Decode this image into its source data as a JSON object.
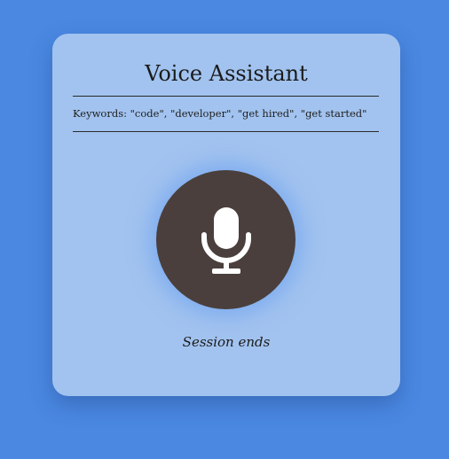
{
  "app": {
    "title": "Voice Assistant",
    "keywords_text": "Keywords: \"code\", \"developer\", \"get hired\", \"get started\""
  },
  "mic_button": {
    "icon": "microphone-icon"
  },
  "status": {
    "text": "Session ends"
  },
  "colors": {
    "background": "#4a88e2",
    "card": "#a2c3ef",
    "mic_button": "#4a3f3c",
    "mic_icon": "#ffffff",
    "glow": "#5a96f0"
  }
}
